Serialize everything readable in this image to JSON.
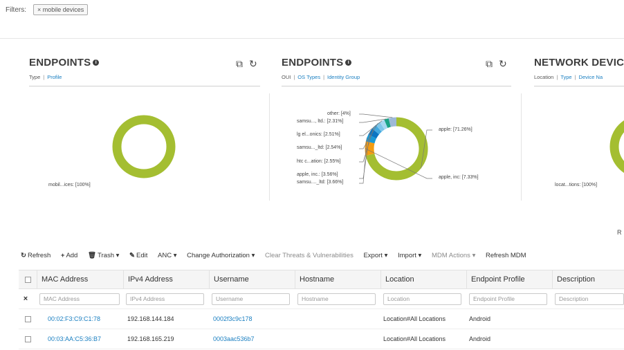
{
  "filters": {
    "label": "Filters:",
    "chip": "× mobile devices"
  },
  "dashlets": [
    {
      "title": "ENDPOINTS",
      "links": [
        "Type",
        "Profile"
      ],
      "active_link": 0,
      "chart_data": {
        "type": "pie",
        "variant": "donut",
        "categories": [
          "mobil...ices"
        ],
        "values": [
          100
        ],
        "labels": [
          "mobil...ices: [100%]"
        ],
        "colors": [
          "#a4be31"
        ]
      }
    },
    {
      "title": "ENDPOINTS",
      "links": [
        "OUI",
        "OS Types",
        "Identity Group"
      ],
      "active_link": 0,
      "chart_data": {
        "type": "pie",
        "variant": "donut",
        "categories": [
          "apple",
          "apple, inc",
          "samsu....ltd",
          "apple, inc.",
          "htc c...ation",
          "samsu..._ltd",
          "lg el...onics",
          "samsu..., ltd.",
          "other"
        ],
        "values": [
          71.26,
          7.33,
          3.66,
          3.56,
          2.55,
          2.54,
          2.51,
          2.31,
          4
        ],
        "labels": [
          "apple: [71.26%]",
          "apple, inc: [7.33%]",
          "samsu...._ltd: [3.66%]",
          "apple, inc.: [3.56%]",
          "htc c...ation: [2.55%]",
          "samsu..._ltd: [2.54%]",
          "lg el...onics: [2.51%]",
          "samsu..., ltd.: [2.31%]",
          "other: [4%]"
        ],
        "colors": [
          "#a4be31",
          "#f39c12",
          "#1a9ad6",
          "#0c75c2",
          "#42a9e0",
          "#7ec6ea",
          "#a6d8f0",
          "#1aa386",
          "#9db9d8"
        ]
      }
    },
    {
      "title": "NETWORK DEVICE",
      "links": [
        "Location",
        "Type",
        "Device Na"
      ],
      "active_link": 0,
      "chart_data": {
        "type": "pie",
        "variant": "donut",
        "categories": [
          "locat...tions"
        ],
        "values": [
          100
        ],
        "labels": [
          "locat...tions: [100%]"
        ],
        "colors": [
          "#a4be31"
        ]
      }
    }
  ],
  "right_edge_text": "R",
  "toolbar": {
    "refresh": "Refresh",
    "add": "Add",
    "trash": "Trash ▾",
    "edit": "Edit",
    "anc": "ANC ▾",
    "change_auth": "Change Authorization ▾",
    "clear_threats": "Clear Threats & Vulnerabilities",
    "export": "Export ▾",
    "import": "Import ▾",
    "mdm_actions": "MDM Actions ▾",
    "refresh_mdm": "Refresh MDM"
  },
  "table": {
    "columns": [
      "MAC Address",
      "IPv4 Address",
      "Username",
      "Hostname",
      "Location",
      "Endpoint Profile",
      "Description"
    ],
    "filter_placeholders": [
      "MAC Address",
      "IPv4 Address",
      "Username",
      "Hostname",
      "Location",
      "Endpoint Profile",
      "Description"
    ],
    "rows": [
      {
        "mac": "00:02:F3:C9:C1:78",
        "ipv4": "192.168.144.184",
        "username": "0002f3c9c178",
        "hostname": "",
        "location": "Location#All Locations",
        "profile": "Android",
        "description": ""
      },
      {
        "mac": "00:03:AA:C5:36:B7",
        "ipv4": "192.168.165.219",
        "username": "0003aac536b7",
        "hostname": "",
        "location": "Location#All Locations",
        "profile": "Android",
        "description": ""
      }
    ]
  }
}
